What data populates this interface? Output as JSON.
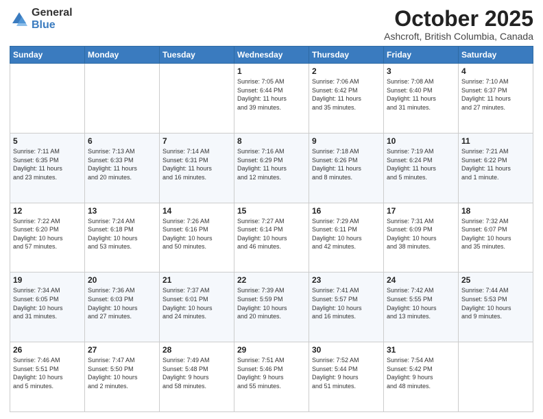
{
  "header": {
    "logo_general": "General",
    "logo_blue": "Blue",
    "title": "October 2025",
    "location": "Ashcroft, British Columbia, Canada"
  },
  "days_of_week": [
    "Sunday",
    "Monday",
    "Tuesday",
    "Wednesday",
    "Thursday",
    "Friday",
    "Saturday"
  ],
  "weeks": [
    [
      {
        "day": "",
        "info": ""
      },
      {
        "day": "",
        "info": ""
      },
      {
        "day": "",
        "info": ""
      },
      {
        "day": "1",
        "info": "Sunrise: 7:05 AM\nSunset: 6:44 PM\nDaylight: 11 hours\nand 39 minutes."
      },
      {
        "day": "2",
        "info": "Sunrise: 7:06 AM\nSunset: 6:42 PM\nDaylight: 11 hours\nand 35 minutes."
      },
      {
        "day": "3",
        "info": "Sunrise: 7:08 AM\nSunset: 6:40 PM\nDaylight: 11 hours\nand 31 minutes."
      },
      {
        "day": "4",
        "info": "Sunrise: 7:10 AM\nSunset: 6:37 PM\nDaylight: 11 hours\nand 27 minutes."
      }
    ],
    [
      {
        "day": "5",
        "info": "Sunrise: 7:11 AM\nSunset: 6:35 PM\nDaylight: 11 hours\nand 23 minutes."
      },
      {
        "day": "6",
        "info": "Sunrise: 7:13 AM\nSunset: 6:33 PM\nDaylight: 11 hours\nand 20 minutes."
      },
      {
        "day": "7",
        "info": "Sunrise: 7:14 AM\nSunset: 6:31 PM\nDaylight: 11 hours\nand 16 minutes."
      },
      {
        "day": "8",
        "info": "Sunrise: 7:16 AM\nSunset: 6:29 PM\nDaylight: 11 hours\nand 12 minutes."
      },
      {
        "day": "9",
        "info": "Sunrise: 7:18 AM\nSunset: 6:26 PM\nDaylight: 11 hours\nand 8 minutes."
      },
      {
        "day": "10",
        "info": "Sunrise: 7:19 AM\nSunset: 6:24 PM\nDaylight: 11 hours\nand 5 minutes."
      },
      {
        "day": "11",
        "info": "Sunrise: 7:21 AM\nSunset: 6:22 PM\nDaylight: 11 hours\nand 1 minute."
      }
    ],
    [
      {
        "day": "12",
        "info": "Sunrise: 7:22 AM\nSunset: 6:20 PM\nDaylight: 10 hours\nand 57 minutes."
      },
      {
        "day": "13",
        "info": "Sunrise: 7:24 AM\nSunset: 6:18 PM\nDaylight: 10 hours\nand 53 minutes."
      },
      {
        "day": "14",
        "info": "Sunrise: 7:26 AM\nSunset: 6:16 PM\nDaylight: 10 hours\nand 50 minutes."
      },
      {
        "day": "15",
        "info": "Sunrise: 7:27 AM\nSunset: 6:14 PM\nDaylight: 10 hours\nand 46 minutes."
      },
      {
        "day": "16",
        "info": "Sunrise: 7:29 AM\nSunset: 6:11 PM\nDaylight: 10 hours\nand 42 minutes."
      },
      {
        "day": "17",
        "info": "Sunrise: 7:31 AM\nSunset: 6:09 PM\nDaylight: 10 hours\nand 38 minutes."
      },
      {
        "day": "18",
        "info": "Sunrise: 7:32 AM\nSunset: 6:07 PM\nDaylight: 10 hours\nand 35 minutes."
      }
    ],
    [
      {
        "day": "19",
        "info": "Sunrise: 7:34 AM\nSunset: 6:05 PM\nDaylight: 10 hours\nand 31 minutes."
      },
      {
        "day": "20",
        "info": "Sunrise: 7:36 AM\nSunset: 6:03 PM\nDaylight: 10 hours\nand 27 minutes."
      },
      {
        "day": "21",
        "info": "Sunrise: 7:37 AM\nSunset: 6:01 PM\nDaylight: 10 hours\nand 24 minutes."
      },
      {
        "day": "22",
        "info": "Sunrise: 7:39 AM\nSunset: 5:59 PM\nDaylight: 10 hours\nand 20 minutes."
      },
      {
        "day": "23",
        "info": "Sunrise: 7:41 AM\nSunset: 5:57 PM\nDaylight: 10 hours\nand 16 minutes."
      },
      {
        "day": "24",
        "info": "Sunrise: 7:42 AM\nSunset: 5:55 PM\nDaylight: 10 hours\nand 13 minutes."
      },
      {
        "day": "25",
        "info": "Sunrise: 7:44 AM\nSunset: 5:53 PM\nDaylight: 10 hours\nand 9 minutes."
      }
    ],
    [
      {
        "day": "26",
        "info": "Sunrise: 7:46 AM\nSunset: 5:51 PM\nDaylight: 10 hours\nand 5 minutes."
      },
      {
        "day": "27",
        "info": "Sunrise: 7:47 AM\nSunset: 5:50 PM\nDaylight: 10 hours\nand 2 minutes."
      },
      {
        "day": "28",
        "info": "Sunrise: 7:49 AM\nSunset: 5:48 PM\nDaylight: 9 hours\nand 58 minutes."
      },
      {
        "day": "29",
        "info": "Sunrise: 7:51 AM\nSunset: 5:46 PM\nDaylight: 9 hours\nand 55 minutes."
      },
      {
        "day": "30",
        "info": "Sunrise: 7:52 AM\nSunset: 5:44 PM\nDaylight: 9 hours\nand 51 minutes."
      },
      {
        "day": "31",
        "info": "Sunrise: 7:54 AM\nSunset: 5:42 PM\nDaylight: 9 hours\nand 48 minutes."
      },
      {
        "day": "",
        "info": ""
      }
    ]
  ]
}
